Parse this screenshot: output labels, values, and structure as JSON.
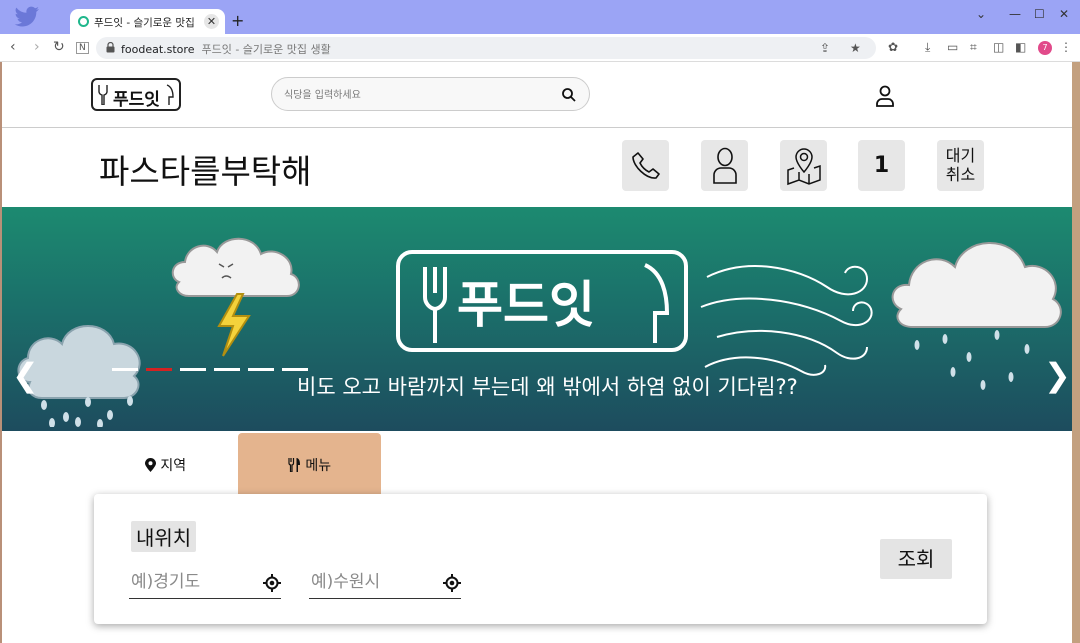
{
  "browser": {
    "tab_title": "푸드잇 - 슬기로운 맛집 생활",
    "new_tab_label": "+",
    "url_host": "foodeat.store",
    "url_title": "푸드잇 - 슬기로운 맛집 생활",
    "profile_badge": "7",
    "window_controls": {
      "dropdown": "⌄",
      "minimize": "—",
      "maximize": "☐",
      "close": "✕"
    }
  },
  "header": {
    "logo_text": "푸드잇",
    "search_placeholder": "식당을 입력하세요"
  },
  "store": {
    "name": "파스타를부탁해",
    "waiting_count": "1",
    "cancel_label_line1": "대기",
    "cancel_label_line2": "취소"
  },
  "banner": {
    "logo_text": "푸드잇",
    "caption": "비도 오고 바람까지 부는데 왜 밖에서 하염 없이 기다림??",
    "prev_arrow": "❮",
    "next_arrow": "❯",
    "slide_count": 6,
    "active_slide": 2
  },
  "tabs": [
    {
      "icon": "map-pin-icon",
      "label": "지역",
      "active": false
    },
    {
      "icon": "utensils-icon",
      "label": "메뉴",
      "active": true
    }
  ],
  "filter": {
    "my_location_label": "내위치",
    "province_placeholder": "예)경기도",
    "city_placeholder": "예)수원시",
    "query_label": "조회"
  },
  "colors": {
    "tabstrip": "#9ba4f5",
    "banner_top": "#1c8a70",
    "banner_bottom": "#1d4c5e",
    "active_tab": "#e4b48e",
    "button_gray": "#e7e7e7",
    "slider_active": "#d42222"
  }
}
